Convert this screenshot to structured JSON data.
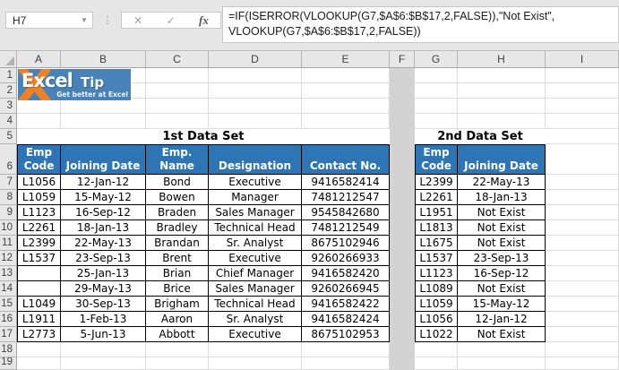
{
  "name_box": {
    "value": "H7"
  },
  "toolbar": {
    "cancel": "✕",
    "enter": "✓",
    "fx": "fx",
    "dots": "⋮",
    "dropdown": "▼"
  },
  "formula": {
    "line1": "=IF(ISERROR(VLOOKUP(G7,$A$6:$B$17,2,FALSE)),\"Not Exist\",",
    "line2": "VLOOKUP(G7,$A$6:$B$17,2,FALSE))"
  },
  "logo": {
    "excel": "Excel",
    "tip": "Tip",
    "tagline": "Get better at Excel"
  },
  "colors": {
    "table_header_blue": "#2E75B6",
    "separator_column_gray": "#D3D3D3",
    "logo_blue": "#4783B8",
    "logo_orange": "#F08123"
  },
  "sheet": {
    "columns": [
      "A",
      "B",
      "C",
      "D",
      "E",
      "F",
      "G",
      "H",
      "I"
    ],
    "rows": [
      "1",
      "2",
      "3",
      "4",
      "5",
      "6",
      "7",
      "8",
      "9",
      "10",
      "11",
      "12",
      "13",
      "14",
      "15",
      "16",
      "17",
      "18",
      "19"
    ],
    "table1": {
      "title": "1st Data Set",
      "headers": [
        "Emp Code",
        "Joining Date",
        "Emp. Name",
        "Designation",
        "Contact No."
      ],
      "rows": [
        [
          "L1056",
          "12-Jan-12",
          "Bond",
          "Executive",
          "9416582414"
        ],
        [
          "L1059",
          "15-May-12",
          "Bowen",
          "Manager",
          "7481212547"
        ],
        [
          "L1123",
          "16-Sep-12",
          "Braden",
          "Sales Manager",
          "9545842680"
        ],
        [
          "L2261",
          "18-Jan-13",
          "Bradley",
          "Technical Head",
          "7481212549"
        ],
        [
          "L2399",
          "22-May-13",
          "Brandan",
          "Sr. Analyst",
          "8675102946"
        ],
        [
          "L1537",
          "23-Sep-13",
          "Brent",
          "Executive",
          "9260266933"
        ],
        [
          "",
          "25-Jan-13",
          "Brian",
          "Chief Manager",
          "9416582420"
        ],
        [
          "",
          "29-May-13",
          "Brice",
          "Sales Manager",
          "9260266945"
        ],
        [
          "L1049",
          "30-Sep-13",
          "Brigham",
          "Technical Head",
          "9416582422"
        ],
        [
          "L1911",
          "1-Feb-13",
          "Aaron",
          "Sr. Analyst",
          "9416582424"
        ],
        [
          "L2773",
          "5-Jun-13",
          "Abbott",
          "Executive",
          "8675102953"
        ]
      ]
    },
    "table2": {
      "title": "2nd Data Set",
      "headers": [
        "Emp Code",
        "Joining Date"
      ],
      "rows": [
        [
          "L2399",
          "22-May-13"
        ],
        [
          "L2261",
          "18-Jan-13"
        ],
        [
          "L1951",
          "Not Exist"
        ],
        [
          "L1813",
          "Not Exist"
        ],
        [
          "L1675",
          "Not Exist"
        ],
        [
          "L1537",
          "23-Sep-13"
        ],
        [
          "L1123",
          "16-Sep-12"
        ],
        [
          "L1089",
          "Not Exist"
        ],
        [
          "L1059",
          "15-May-12"
        ],
        [
          "L1056",
          "12-Jan-12"
        ],
        [
          "L1022",
          "Not Exist"
        ]
      ]
    }
  }
}
